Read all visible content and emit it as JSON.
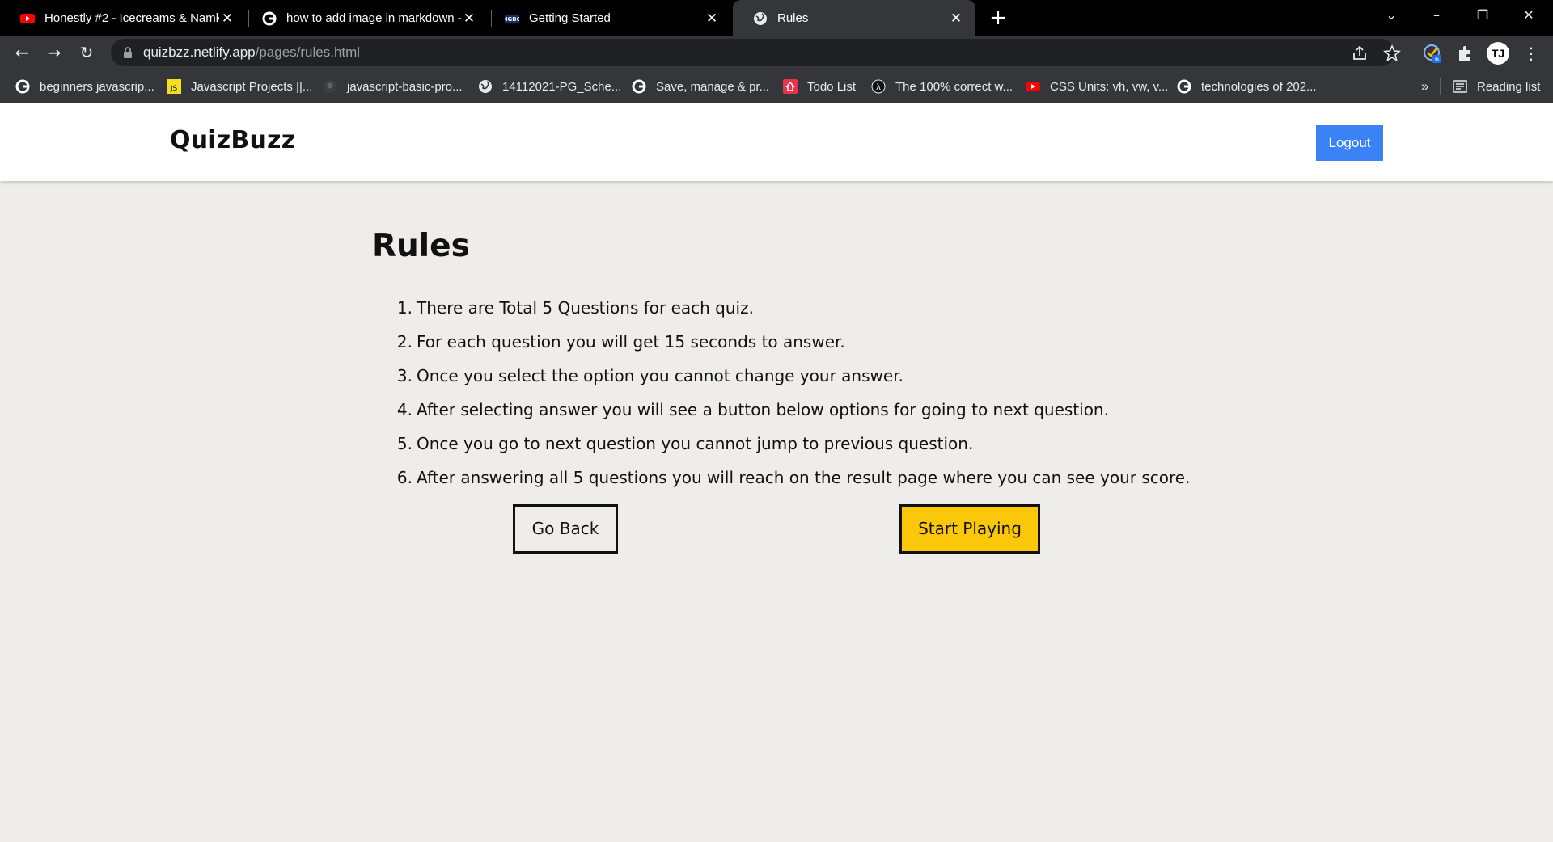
{
  "browser": {
    "tabs": [
      {
        "title": "Honestly #2 - Icecreams & Namk",
        "icon": "youtube-icon"
      },
      {
        "title": "how to add image in markdown -",
        "icon": "google-icon"
      },
      {
        "title": "Getting Started",
        "icon": "ngbg-icon"
      },
      {
        "title": "Rules",
        "icon": "globe-icon",
        "active": true
      }
    ],
    "url_host": "quizbzz.netlify.app",
    "url_path": "/pages/rules.html",
    "extension_badge": "6",
    "profile_initials": "TJ",
    "bookmarks": [
      {
        "label": "beginners javascrip...",
        "icon": "google-icon"
      },
      {
        "label": "Javascript Projects ||...",
        "icon": "js-icon"
      },
      {
        "label": "javascript-basic-pro...",
        "icon": "github-icon"
      },
      {
        "label": "14112021-PG_Sche...",
        "icon": "globe-icon"
      },
      {
        "label": "Save, manage & pr...",
        "icon": "google-icon"
      },
      {
        "label": "Todo List",
        "icon": "todo-icon"
      },
      {
        "label": "The 100% correct w...",
        "icon": "lambda-icon"
      },
      {
        "label": "CSS Units: vh, vw, v...",
        "icon": "youtube-icon"
      },
      {
        "label": "technologies of 202...",
        "icon": "google-icon"
      }
    ],
    "overflow_label": "»",
    "reading_list_label": "Reading list"
  },
  "header": {
    "brand": "QuizBuzz",
    "logout_label": "Logout"
  },
  "main": {
    "title": "Rules",
    "rules": [
      {
        "num": "1.",
        "text": "There are Total 5 Questions for each quiz."
      },
      {
        "num": "2.",
        "text": "For each question you will get 15 seconds to answer."
      },
      {
        "num": "3.",
        "text": "Once you select the option you cannot change your answer."
      },
      {
        "num": "4.",
        "text": "After selecting answer you will see a button below options for going to next question."
      },
      {
        "num": "5.",
        "text": "Once you go to next question you cannot jump to previous question."
      },
      {
        "num": "6.",
        "text": "After answering all 5 questions you will reach on the result page where you can see your score."
      }
    ],
    "go_back_label": "Go Back",
    "start_label": "Start Playing"
  },
  "colors": {
    "page_bg": "#efedea",
    "logout_bg": "#3b82f6",
    "start_bg": "#fbc70b"
  }
}
